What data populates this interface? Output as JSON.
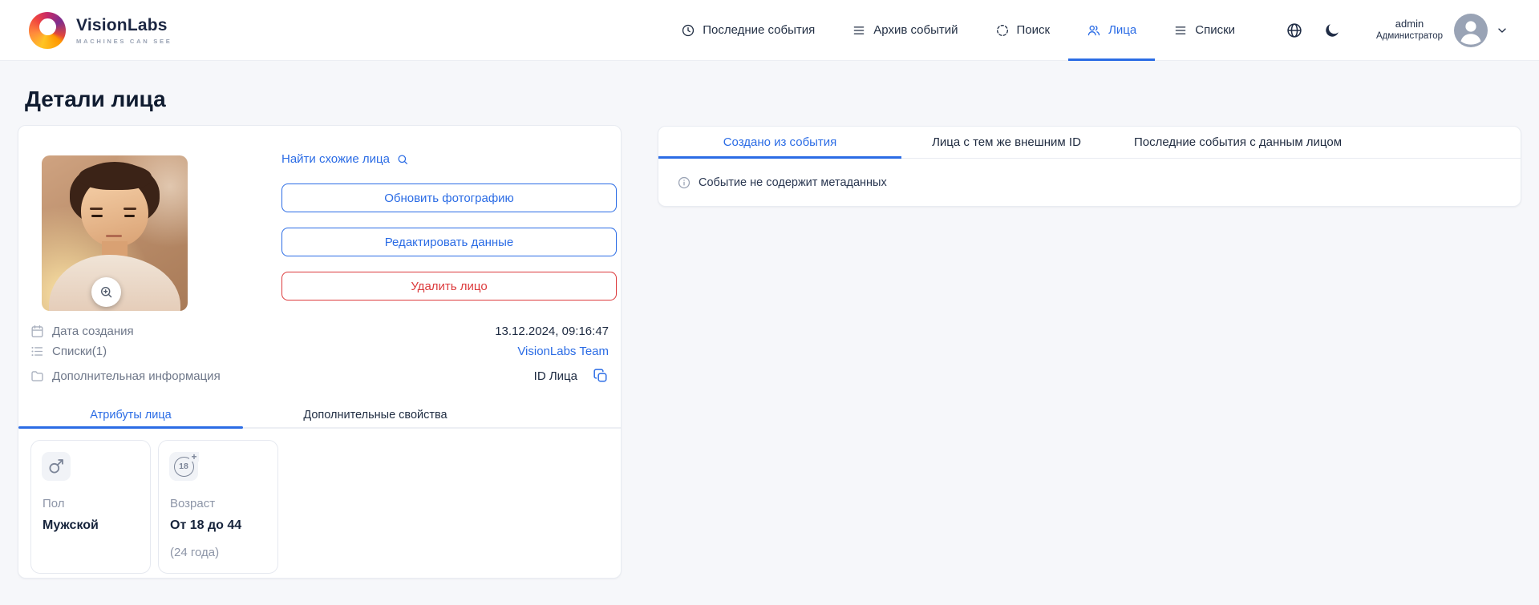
{
  "brand": {
    "name": "VisionLabs",
    "tagline": "MACHINES CAN SEE"
  },
  "nav": {
    "items": [
      {
        "label": "Последние события"
      },
      {
        "label": "Архив событий"
      },
      {
        "label": "Поиск"
      },
      {
        "label": "Лица"
      },
      {
        "label": "Списки"
      }
    ],
    "user": {
      "name": "admin",
      "role": "Администратор"
    }
  },
  "page": {
    "title": "Детали лица"
  },
  "face_card": {
    "find_similar": "Найти схожие лица",
    "update_photo": "Обновить фотографию",
    "edit_data": "Редактировать данные",
    "delete_face": "Удалить лицо",
    "meta": {
      "created_label": "Дата создания",
      "created_value": "13.12.2024, 09:16:47",
      "lists_label": "Списки(1)",
      "lists_value": "VisionLabs Team",
      "extra_label": "Дополнительная информация",
      "face_id_label": "ID Лица"
    },
    "tabs": {
      "attributes": "Атрибуты лица",
      "properties": "Дополнительные свойства"
    },
    "attributes": [
      {
        "label": "Пол",
        "value": "Мужской"
      },
      {
        "label": "Возраст",
        "value": "От 18 до 44",
        "note": "(24 года)"
      }
    ],
    "age_icon": {
      "num": "18",
      "plus": "+"
    }
  },
  "events_panel": {
    "tabs": [
      "Создано из события",
      "Лица с тем же внешним ID",
      "Последние события с данным лицом"
    ],
    "empty_message": "Событие не содержит метаданных"
  },
  "colors": {
    "primary": "#2b6ce5",
    "danger": "#dc3a3c",
    "text_dark": "#1f2b40",
    "text_gray": "#8d95a7"
  }
}
